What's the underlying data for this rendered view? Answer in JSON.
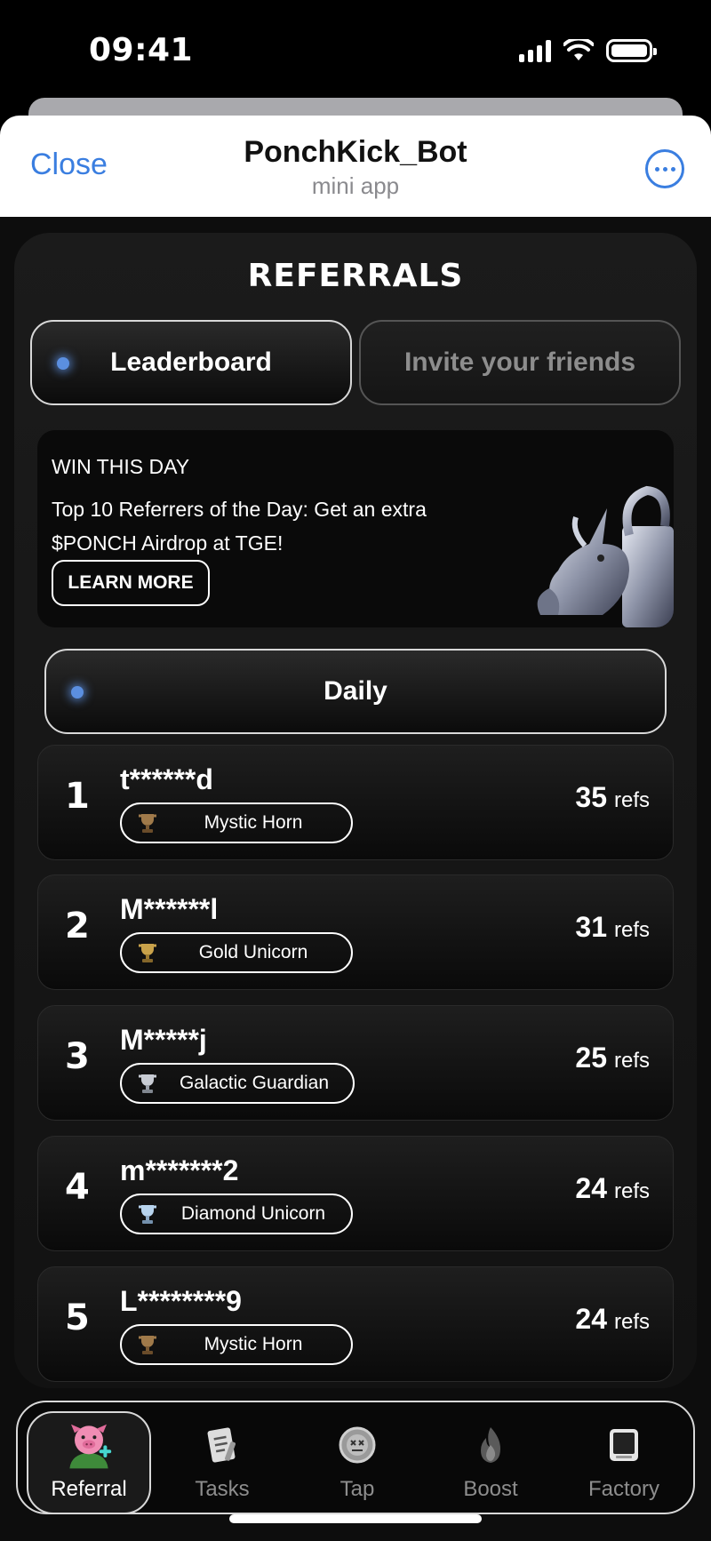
{
  "status_bar": {
    "time": "09:41"
  },
  "telegram": {
    "close_label": "Close",
    "bot_name": "PonchKick_Bot",
    "subtitle": "mini app"
  },
  "page": {
    "title": "REFERRALS"
  },
  "tabs": [
    {
      "label": "Leaderboard",
      "active": true
    },
    {
      "label": "Invite your friends",
      "active": false
    }
  ],
  "promo": {
    "label": "WIN THIS DAY",
    "text": "Top 10 Referrers of the Day: Get an extra $PONCH Airdrop at TGE!",
    "button_label": "LEARN MORE"
  },
  "period_selector": {
    "label": "Daily"
  },
  "leaderboard": [
    {
      "rank": "1",
      "name": "t******d",
      "badge": "Mystic Horn",
      "badge_icon": "bronze-trophy-icon",
      "refs": "35",
      "unit": "refs"
    },
    {
      "rank": "2",
      "name": "M******l",
      "badge": "Gold Unicorn",
      "badge_icon": "gold-trophy-icon",
      "refs": "31",
      "unit": "refs"
    },
    {
      "rank": "3",
      "name": "M*****j",
      "badge": "Galactic Guardian",
      "badge_icon": "silver-trophy-icon",
      "refs": "25",
      "unit": "refs"
    },
    {
      "rank": "4",
      "name": "m*******2",
      "badge": "Diamond Unicorn",
      "badge_icon": "diamond-trophy-icon",
      "refs": "24",
      "unit": "refs"
    },
    {
      "rank": "5",
      "name": "L********9",
      "badge": "Mystic Horn",
      "badge_icon": "bronze-trophy-icon",
      "refs": "24",
      "unit": "refs"
    }
  ],
  "nav": [
    {
      "label": "Referral",
      "icon": "pig-mascot-icon",
      "active": true
    },
    {
      "label": "Tasks",
      "icon": "clipboard-icon",
      "active": false
    },
    {
      "label": "Tap",
      "icon": "coin-icon",
      "active": false
    },
    {
      "label": "Boost",
      "icon": "flame-icon",
      "active": false
    },
    {
      "label": "Factory",
      "icon": "device-icon",
      "active": false
    }
  ],
  "colors": {
    "accent_blue": "#5b8fe0",
    "telegram_blue": "#3a7ee0",
    "background": "#0d0d0d"
  }
}
